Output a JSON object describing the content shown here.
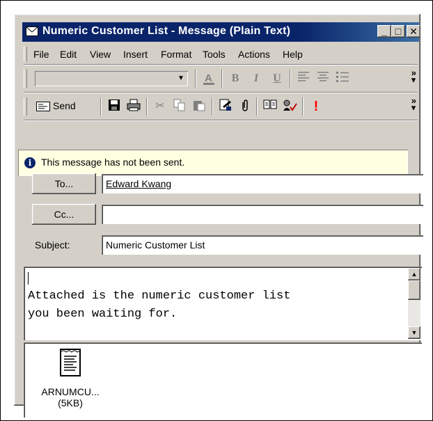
{
  "window": {
    "title": "Numeric Customer List - Message (Plain Text)",
    "minimize": "_",
    "maximize": "□",
    "close": "✕"
  },
  "menu": [
    "File",
    "Edit",
    "View",
    "Insert",
    "Format",
    "Tools",
    "Actions",
    "Help"
  ],
  "format_toolbar": {
    "font_value": "",
    "icons": [
      "font-color-icon",
      "bold-icon",
      "italic-icon",
      "underline-icon",
      "align-left-icon",
      "center-icon",
      "bullets-icon"
    ],
    "bold": "B",
    "italic": "I",
    "underline": "U"
  },
  "standard_toolbar": {
    "send_label": "Send",
    "icons": [
      "save-icon",
      "print-icon",
      "cut-icon",
      "copy-icon",
      "paste-icon",
      "check-names-icon",
      "attach-icon",
      "address-book-icon",
      "check-icon",
      "importance-high-icon"
    ],
    "importance": "!"
  },
  "infobar": {
    "icon": "i",
    "text": "This message has not been sent."
  },
  "header": {
    "to_button": "To...",
    "to_value": "Edward Kwang",
    "cc_button": "Cc...",
    "cc_value": "",
    "subject_label": "Subject:",
    "subject_value": "Numeric Customer List"
  },
  "body": {
    "line1": "Attached is the numeric customer list",
    "line2": "you been waiting for."
  },
  "attachment": {
    "name": "ARNUMCU...",
    "size": "(5KB)",
    "icon": "text-document-icon"
  },
  "colors": {
    "titlebar": "#0a246a",
    "face": "#d4d0c8",
    "infobar": "#ffffe1",
    "importance": "#ff0000"
  }
}
